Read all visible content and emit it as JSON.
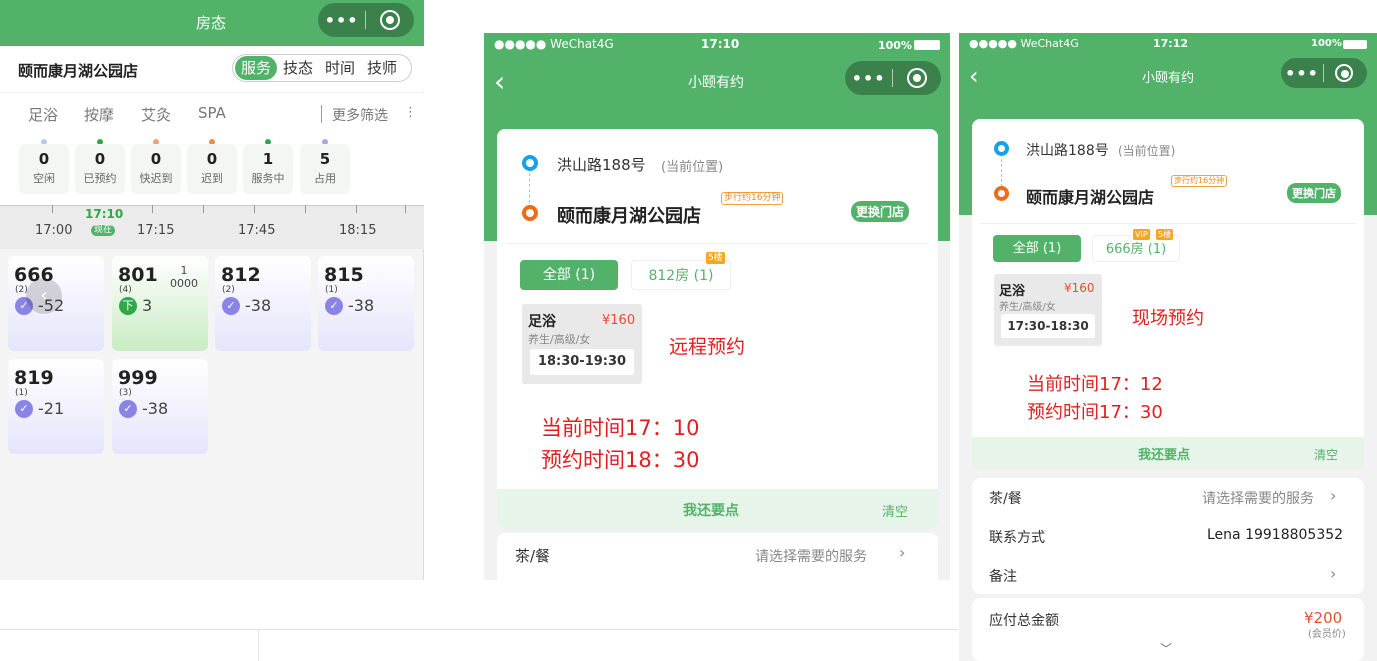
{
  "panel1": {
    "header_title": "房态",
    "store_name": "颐而康月湖公园店",
    "view_tabs": [
      "服务",
      "技态",
      "时间",
      "技师"
    ],
    "filters": [
      "足浴",
      "按摩",
      "艾灸",
      "SPA"
    ],
    "more_filters": "更多筛选",
    "stats": [
      {
        "count": "0",
        "label": "空闲",
        "color": "#b8c8f0"
      },
      {
        "count": "0",
        "label": "已预约",
        "color": "#2fa84a"
      },
      {
        "count": "0",
        "label": "快迟到",
        "color": "#f2a070"
      },
      {
        "count": "0",
        "label": "迟到",
        "color": "#f08a3c"
      },
      {
        "count": "1",
        "label": "服务中",
        "color": "#2fa84a"
      },
      {
        "count": "5",
        "label": "占用",
        "color": "#a9a4f0"
      }
    ],
    "timeline": {
      "current": "17:10",
      "now_badge": "现在",
      "ticks": [
        "17:00",
        "17:15",
        "17:45",
        "18:15"
      ]
    },
    "rooms": [
      {
        "num": "666",
        "cnt": "(2)",
        "val": "-52",
        "extra": ""
      },
      {
        "num": "801",
        "cnt": "(4)",
        "val": "3",
        "extra": "1\n0000"
      },
      {
        "num": "812",
        "cnt": "(2)",
        "val": "-38",
        "extra": ""
      },
      {
        "num": "815",
        "cnt": "(1)",
        "val": "-38",
        "extra": ""
      },
      {
        "num": "819",
        "cnt": "(1)",
        "val": "-21",
        "extra": ""
      },
      {
        "num": "999",
        "cnt": "(3)",
        "val": "-38",
        "extra": ""
      }
    ],
    "room_badge": "下"
  },
  "panel2": {
    "status_carrier": "●●●●● WeChat4G",
    "status_time": "17:10",
    "status_battery": "100%",
    "nav_title": "小颐有约",
    "loc_from": "洪山路188号",
    "loc_from_note": "(当前位置)",
    "loc_to": "颐而康月湖公园店",
    "walk_badge": "步行约16分钟",
    "change_store": "更换门店",
    "tab_all": "全部 (1)",
    "tab_room": "812房 (1)",
    "floor_badge": "5楼",
    "service_name": "足浴",
    "service_price": "¥160",
    "service_desc": "养生/高级/女",
    "service_time": "18:30-19:30",
    "note_type": "远程预约",
    "note_current": "当前时间17：10",
    "note_booking": "预约时间18：30",
    "more_order": "我还要点",
    "clear": "清空",
    "tea_label": "茶/餐",
    "tea_hint": "请选择需要的服务"
  },
  "panel3": {
    "status_carrier": "●●●●● WeChat4G",
    "status_time": "17:12",
    "status_battery": "100%",
    "nav_title": "小颐有约",
    "loc_from": "洪山路188号",
    "loc_from_note": "(当前位置)",
    "loc_to": "颐而康月湖公园店",
    "walk_badge": "步行约16分钟",
    "change_store": "更换门店",
    "tab_all": "全部 (1)",
    "tab_room": "666房 (1)",
    "vip_badge": "VIP",
    "floor_badge": "5楼",
    "service_name": "足浴",
    "service_price": "¥160",
    "service_desc": "养生/高级/女",
    "service_time": "17:30-18:30",
    "note_type": "现场预约",
    "note_current": "当前时间17：12",
    "note_booking": "预约时间17：30",
    "more_order": "我还要点",
    "clear": "清空",
    "tea_label": "茶/餐",
    "tea_hint": "请选择需要的服务",
    "contact_label": "联系方式",
    "contact_value": "Lena 19918805352",
    "remark_label": "备注",
    "total_label": "应付总金额",
    "total_value": "¥200",
    "total_note": "(会员价)"
  }
}
